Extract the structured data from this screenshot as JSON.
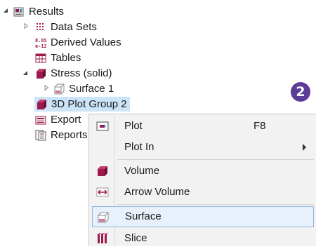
{
  "tree": {
    "results": "Results",
    "data_sets": "Data Sets",
    "derived_values": "Derived Values",
    "derived_icon_text": "8.85\ne-12",
    "tables": "Tables",
    "stress": "Stress (solid)",
    "surface1": "Surface 1",
    "plot_group": "3D Plot Group 2",
    "export": "Export",
    "reports": "Reports"
  },
  "badge": "2",
  "menu": {
    "plot": "Plot",
    "plot_shortcut": "F8",
    "plot_in": "Plot In",
    "volume": "Volume",
    "arrow_volume": "Arrow Volume",
    "surface": "Surface",
    "slice": "Slice"
  },
  "colors": {
    "accent_magenta": "#9c1a4e",
    "selection": "#cce4f7",
    "badge": "#5b3d99",
    "menu_hover": "#e8f1fb"
  },
  "icons": {
    "results": "results-folder-icon",
    "data_sets": "grid-dots-icon",
    "derived_values": "number-icon",
    "tables": "table-icon",
    "stress": "magenta-cube-icon",
    "surface": "surface-icon",
    "plot_group": "magenta-cube-icon",
    "export": "export-icon",
    "reports": "reports-icon"
  }
}
